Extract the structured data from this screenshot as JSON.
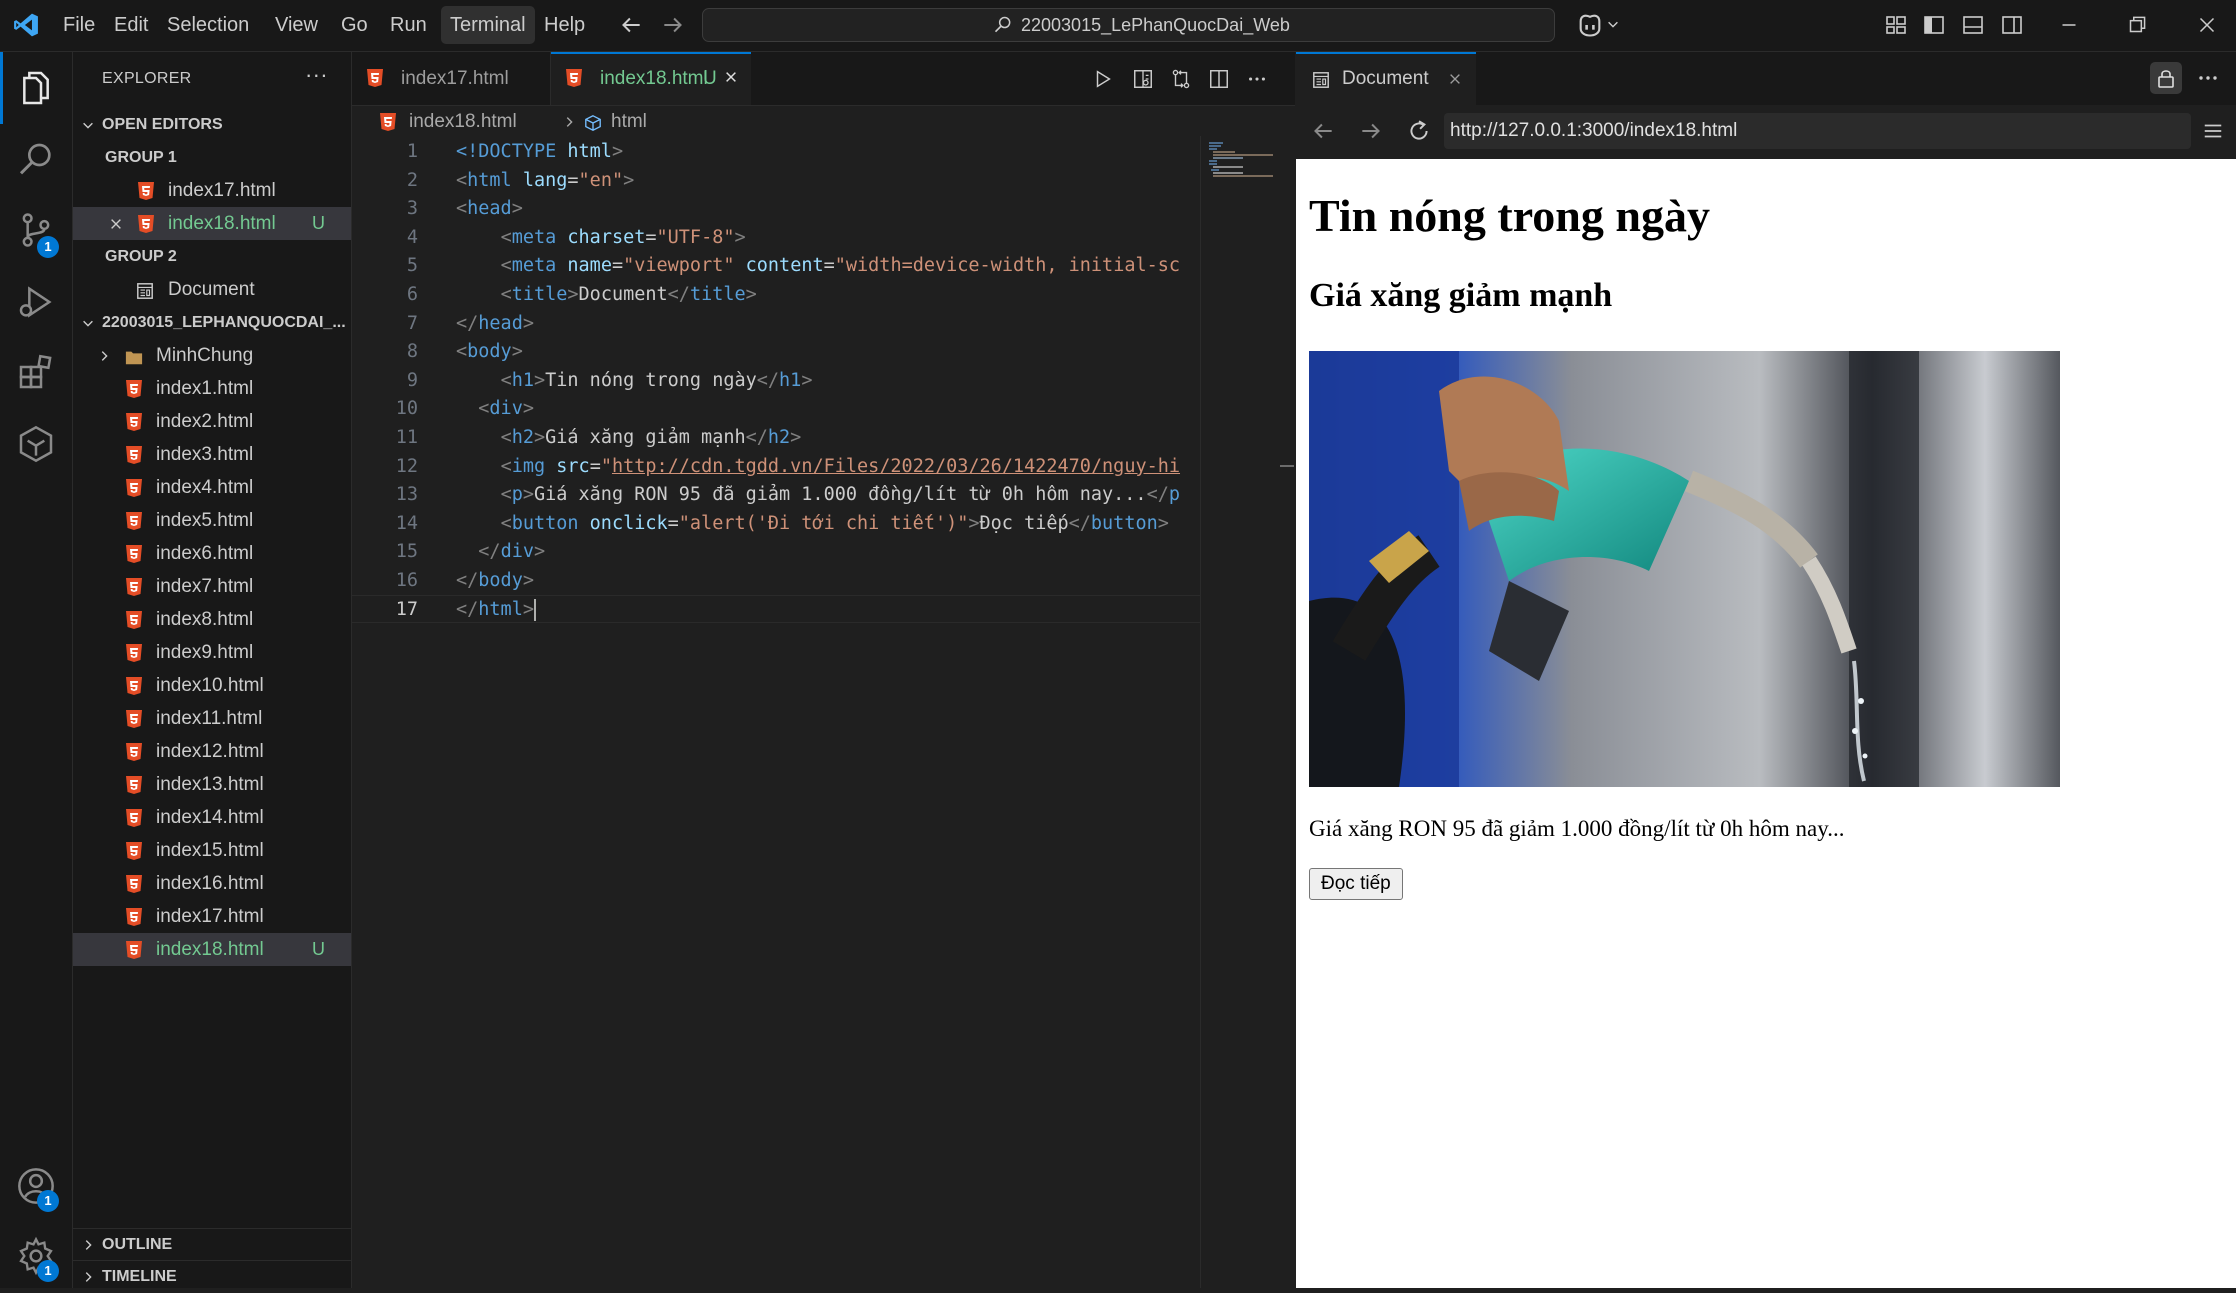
{
  "titlebar": {
    "menu": [
      "File",
      "Edit",
      "Selection",
      "View",
      "Go",
      "Run",
      "Terminal",
      "Help"
    ],
    "active_menu": "Terminal",
    "search_text": "22003015_LePhanQuocDai_Web"
  },
  "activitybar": {
    "source_control_badge": "1",
    "accounts_badge": "1",
    "settings_badge": "1"
  },
  "sidebar": {
    "title": "EXPLORER",
    "more": "···",
    "open_editors_label": "OPEN EDITORS",
    "group1_label": "GROUP 1",
    "group1_items": [
      "index17.html",
      "index18.html"
    ],
    "group2_label": "GROUP 2",
    "group2_items": [
      "Document"
    ],
    "workspace_label": "22003015_LEPHANQUOCDAI_...",
    "folder": "MinhChung",
    "files": [
      "index1.html",
      "index2.html",
      "index3.html",
      "index4.html",
      "index5.html",
      "index6.html",
      "index7.html",
      "index8.html",
      "index9.html",
      "index10.html",
      "index11.html",
      "index12.html",
      "index13.html",
      "index14.html",
      "index15.html",
      "index16.html",
      "index17.html",
      "index18.html"
    ],
    "untracked_badge": "U",
    "outline_label": "OUTLINE",
    "timeline_label": "TIMELINE"
  },
  "editor": {
    "tabs": [
      {
        "label": "index17.html",
        "status": ""
      },
      {
        "label": "index18.html",
        "status": "U"
      }
    ],
    "breadcrumb": [
      "index18.html",
      "html"
    ],
    "line_numbers": [
      "1",
      "2",
      "3",
      "4",
      "5",
      "6",
      "7",
      "8",
      "9",
      "10",
      "11",
      "12",
      "13",
      "14",
      "15",
      "16",
      "17"
    ],
    "code": {
      "l1_doctype": "<!DOCTYPE",
      "l1_html": "html",
      "l1_close": ">",
      "l2": {
        "open": "<",
        "tag": "html",
        "attr": "lang",
        "eq": "=",
        "val": "\"en\"",
        "close": ">"
      },
      "l3": {
        "open": "<",
        "tag": "head",
        "close": ">"
      },
      "l4": {
        "open": "<",
        "tag": "meta",
        "attr": "charset",
        "eq": "=",
        "val": "\"UTF-8\"",
        "close": ">"
      },
      "l5": {
        "open": "<",
        "tag": "meta",
        "attr1": "name",
        "eq": "=",
        "val1": "\"viewport\"",
        "attr2": "content",
        "val2": "\"width=device-width, initial-sc"
      },
      "l6": {
        "open": "<",
        "tag": "title",
        "mid": ">",
        "text": "Document",
        "close_open": "</",
        "close_tag": "title",
        "close": ">"
      },
      "l7": {
        "open": "</",
        "tag": "head",
        "close": ">"
      },
      "l8": {
        "open": "<",
        "tag": "body",
        "close": ">"
      },
      "l9": {
        "open": "<",
        "tag": "h1",
        "mid": ">",
        "text": "Tin nóng trong ngày",
        "close_open": "</",
        "close_tag": "h1",
        "close": ">"
      },
      "l10": {
        "open": "<",
        "tag": "div",
        "close": ">"
      },
      "l11": {
        "open": "<",
        "tag": "h2",
        "mid": ">",
        "text": "Giá xăng giảm mạnh",
        "close_open": "</",
        "close_tag": "h2",
        "close": ">"
      },
      "l12": {
        "open": "<",
        "tag": "img",
        "attr": "src",
        "eq": "=",
        "q": "\"",
        "url": "http://cdn.tgdd.vn/Files/2022/03/26/1422470/nguy-hi"
      },
      "l13": {
        "open": "<",
        "tag": "p",
        "mid": ">",
        "text": "Giá xăng RON 95 đã giảm 1.000 đồng/lít từ 0h hôm nay...",
        "close_open": "</",
        "close_tag": "p"
      },
      "l14": {
        "open": "<",
        "tag": "button",
        "attr": "onclick",
        "eq": "=",
        "val": "\"alert('Đi tới chi tiết')\"",
        "mid": ">",
        "text": "Đọc tiếp",
        "close_open": "</",
        "close_tag": "button",
        "close": ">"
      },
      "l15": {
        "open": "</",
        "tag": "div",
        "close": ">"
      },
      "l16": {
        "open": "</",
        "tag": "body",
        "close": ">"
      },
      "l17": {
        "open": "</",
        "tag": "html",
        "close": ">"
      }
    }
  },
  "browser": {
    "tab_label": "Document",
    "url": "http://127.0.0.1:3000/index18.html",
    "page": {
      "h1": "Tin nóng trong ngày",
      "h2": "Giá xăng giảm mạnh",
      "p": "Giá xăng RON 95 đã giảm 1.000 đồng/lít từ 0h hôm nay...",
      "button": "Đọc tiếp"
    }
  },
  "colors": {
    "accent": "#0078d4",
    "untracked": "#73c991",
    "html_icon": "#e44d26"
  }
}
